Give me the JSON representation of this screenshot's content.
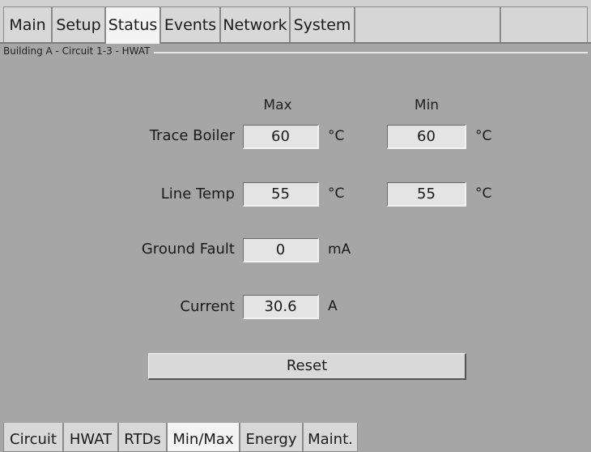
{
  "top_tabs": [
    {
      "label": "Main",
      "active": false
    },
    {
      "label": "Setup",
      "active": false
    },
    {
      "label": "Status",
      "active": true
    },
    {
      "label": "Events",
      "active": false
    },
    {
      "label": "Network",
      "active": false
    },
    {
      "label": "System",
      "active": false
    }
  ],
  "group": {
    "title": "Building A - Circuit 1-3 - HWAT"
  },
  "columns": {
    "max": "Max",
    "min": "Min"
  },
  "rows": {
    "trace_boiler": {
      "label": "Trace Boiler",
      "max": "60",
      "max_unit": "°C",
      "min": "60",
      "min_unit": "°C"
    },
    "line_temp": {
      "label": "Line Temp",
      "max": "55",
      "max_unit": "°C",
      "min": "55",
      "min_unit": "°C"
    },
    "ground_fault": {
      "label": "Ground Fault",
      "value": "0",
      "unit": "mA"
    },
    "current": {
      "label": "Current",
      "value": "30.6",
      "unit": "A"
    }
  },
  "reset_label": "Reset",
  "bottom_tabs": [
    {
      "label": "Circuit",
      "active": false
    },
    {
      "label": "HWAT",
      "active": false
    },
    {
      "label": "RTDs",
      "active": false
    },
    {
      "label": "Min/Max",
      "active": true
    },
    {
      "label": "Energy",
      "active": false
    },
    {
      "label": "Maint.",
      "active": false
    }
  ]
}
